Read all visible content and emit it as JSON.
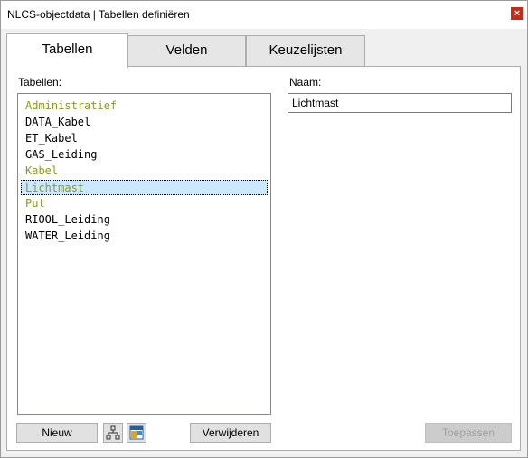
{
  "window": {
    "title": "NLCS-objectdata  |  Tabellen definiëren",
    "close_glyph": "×"
  },
  "tabs": [
    {
      "label": "Tabellen",
      "active": true
    },
    {
      "label": "Velden",
      "active": false
    },
    {
      "label": "Keuzelijsten",
      "active": false
    }
  ],
  "tables_panel": {
    "label": "Tabellen:",
    "items": [
      {
        "label": "Administratief",
        "color": "#8a9a1f"
      },
      {
        "label": "DATA_Kabel",
        "color": "#000000"
      },
      {
        "label": "ET_Kabel",
        "color": "#000000"
      },
      {
        "label": "GAS_Leiding",
        "color": "#000000"
      },
      {
        "label": "Kabel",
        "color": "#8a9a1f"
      },
      {
        "label": "Lichtmast",
        "color": "#8a9a1f",
        "selected": true
      },
      {
        "label": "Put",
        "color": "#8a9a1f"
      },
      {
        "label": "RIOOL_Leiding",
        "color": "#000000"
      },
      {
        "label": "WATER_Leiding",
        "color": "#000000"
      }
    ]
  },
  "name_panel": {
    "label": "Naam:",
    "value": "Lichtmast"
  },
  "buttons": {
    "new_label": "Nieuw",
    "delete_label": "Verwijderen",
    "apply_label": "Toepassen"
  },
  "icons": {
    "hierarchy": "hierarchy-icon",
    "table_color": "table-color-icon"
  }
}
